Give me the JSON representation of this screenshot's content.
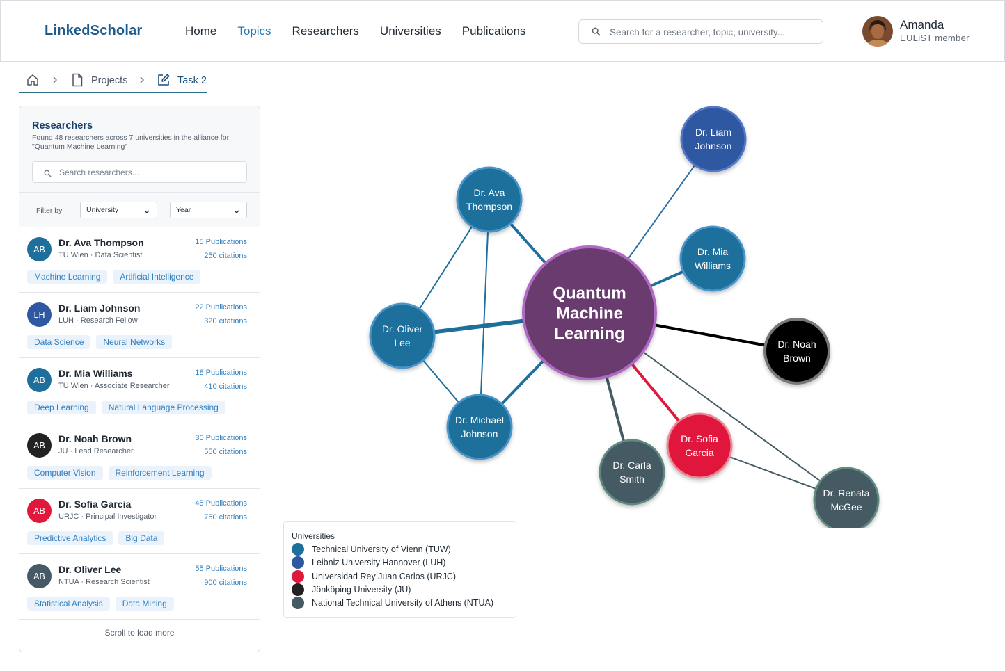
{
  "app": {
    "logo": "LinkedScholar"
  },
  "nav": [
    {
      "label": "Home",
      "active": false
    },
    {
      "label": "Topics",
      "active": true
    },
    {
      "label": "Researchers",
      "active": false
    },
    {
      "label": "Universities",
      "active": false
    },
    {
      "label": "Publications",
      "active": false
    }
  ],
  "search": {
    "placeholder": "Search for a researcher, topic, university..."
  },
  "user": {
    "name": "Amanda",
    "role": "EULiST member"
  },
  "breadcrumb": {
    "projects": "Projects",
    "task": "Task 2"
  },
  "panel": {
    "title": "Researchers",
    "description": "Found 48 researchers across 7 universities in the alliance for: \"Quantum Machine Learning\"",
    "search_placeholder": "Search researchers...",
    "filter_label": "Filter by",
    "filter_university": "University",
    "filter_year": "Year",
    "load_more": "Scroll to load more"
  },
  "researchers": [
    {
      "initials": "AB",
      "name": "Dr. Ava Thompson",
      "sub": "TU Wien · Data Scientist",
      "pubs": "15 Publications",
      "cites": "250 citations",
      "color": "#1e6f9b",
      "tags": [
        "Machine Learning",
        "Artificial Intelligence"
      ]
    },
    {
      "initials": "LH",
      "name": "Dr. Liam Johnson",
      "sub": "LUH · Research Fellow",
      "pubs": "22 Publications",
      "cites": "320 citations",
      "color": "#2e58a1",
      "tags": [
        "Data Science",
        "Neural Networks"
      ]
    },
    {
      "initials": "AB",
      "name": "Dr. Mia Williams",
      "sub": "TU Wien · Associate Researcher",
      "pubs": "18 Publications",
      "cites": "410 citations",
      "color": "#1e6f9b",
      "tags": [
        "Deep Learning",
        "Natural Language Processing"
      ]
    },
    {
      "initials": "AB",
      "name": "Dr. Noah Brown",
      "sub": "JU · Lead Researcher",
      "pubs": "30 Publications",
      "cites": "550 citations",
      "color": "#222222",
      "tags": [
        "Computer Vision",
        "Reinforcement Learning"
      ]
    },
    {
      "initials": "AB",
      "name": "Dr. Sofia Garcia",
      "sub": "URJC · Principal Investigator",
      "pubs": "45 Publications",
      "cites": "750 citations",
      "color": "#e0193c",
      "tags": [
        "Predictive Analytics",
        "Big Data"
      ]
    },
    {
      "initials": "AB",
      "name": "Dr. Oliver Lee",
      "sub": "NTUA · Research Scientist",
      "pubs": "55 Publications",
      "cites": "900 citations",
      "color": "#455a64",
      "tags": [
        "Statistical Analysis",
        "Data Mining"
      ]
    }
  ],
  "graph": {
    "center_lines": [
      "Quantum",
      "Machine",
      "Learning"
    ],
    "nodes": [
      {
        "id": "ava",
        "lines": [
          "Dr. Ava",
          "Thompson"
        ],
        "fill": "#1e6f9b",
        "ring": "#4a95c9"
      },
      {
        "id": "liam",
        "lines": [
          "Dr. Liam",
          "Johnson"
        ],
        "fill": "#2e58a1",
        "ring": "#5577c4"
      },
      {
        "id": "mia",
        "lines": [
          "Dr. Mia",
          "Williams"
        ],
        "fill": "#1e6f9b",
        "ring": "#4a95c9"
      },
      {
        "id": "oliver",
        "lines": [
          "Dr. Oliver",
          "Lee"
        ],
        "fill": "#1e6f9b",
        "ring": "#4a95c9"
      },
      {
        "id": "noah",
        "lines": [
          "Dr. Noah",
          "Brown"
        ],
        "fill": "#000000",
        "ring": "#777777"
      },
      {
        "id": "michael",
        "lines": [
          "Dr. Michael",
          "Johnson"
        ],
        "fill": "#1e6f9b",
        "ring": "#4a95c9"
      },
      {
        "id": "sofia",
        "lines": [
          "Dr. Sofia",
          "Garcia"
        ],
        "fill": "#e0193c",
        "ring": "#ec8896"
      },
      {
        "id": "carla",
        "lines": [
          "Dr. Carla",
          "Smith"
        ],
        "fill": "#455a64",
        "ring": "#5f8a80"
      },
      {
        "id": "renata",
        "lines": [
          "Dr. Renata",
          "McGee"
        ],
        "fill": "#455a64",
        "ring": "#5f8a80"
      }
    ],
    "edges": [
      {
        "from": "center",
        "to": "liam",
        "color": "#2e6fa6"
      },
      {
        "from": "center",
        "to": "mia",
        "color": "#1e6f9b"
      },
      {
        "from": "center",
        "to": "noah",
        "color": "#000000"
      },
      {
        "from": "center",
        "to": "sofia",
        "color": "#e0193c"
      },
      {
        "from": "center",
        "to": "carla",
        "color": "#455a64"
      },
      {
        "from": "center",
        "to": "renata",
        "color": "#455a64"
      },
      {
        "from": "center",
        "to": "ava",
        "color": "#1e6f9b"
      },
      {
        "from": "center",
        "to": "oliver",
        "color": "#1e6f9b"
      },
      {
        "from": "center",
        "to": "michael",
        "color": "#1e6f9b"
      },
      {
        "from": "ava",
        "to": "oliver",
        "color": "#1e6f9b"
      },
      {
        "from": "ava",
        "to": "michael",
        "color": "#1e6f9b"
      },
      {
        "from": "oliver",
        "to": "michael",
        "color": "#1e6f9b"
      },
      {
        "from": "sofia",
        "to": "renata",
        "color": "#455a64"
      }
    ]
  },
  "legend": {
    "title": "Universities",
    "items": [
      {
        "label": "Technical University of Vienn (TUW)",
        "color": "#1e6f9b"
      },
      {
        "label": "Leibniz University Hannover (LUH)",
        "color": "#2e58a1"
      },
      {
        "label": "Universidad Rey Juan Carlos (URJC)",
        "color": "#e0193c"
      },
      {
        "label": "Jönköping University (JU)",
        "color": "#222222"
      },
      {
        "label": "National Technical University of Athens (NTUA)",
        "color": "#455a64"
      }
    ]
  }
}
